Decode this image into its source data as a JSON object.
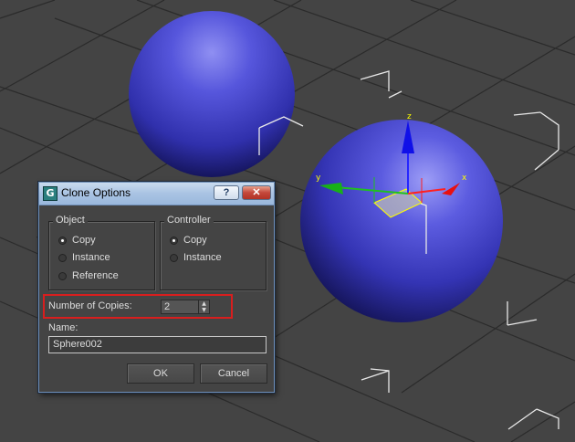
{
  "dialog": {
    "title": "Clone Options",
    "help_label": "?",
    "close_label": "✕",
    "object_group": {
      "legend": "Object",
      "options": [
        "Copy",
        "Instance",
        "Reference"
      ],
      "selected": "Copy"
    },
    "controller_group": {
      "legend": "Controller",
      "options": [
        "Copy",
        "Instance"
      ],
      "selected": "Copy"
    },
    "copies": {
      "label": "Number of Copies:",
      "value": "2"
    },
    "name": {
      "label": "Name:",
      "value": "Sphere002"
    },
    "ok_label": "OK",
    "cancel_label": "Cancel"
  },
  "viewport": {
    "background_color": "#444444",
    "grid_color": "#2b2b2b",
    "sphere_color": "#3f3fc0",
    "gizmo": {
      "x_label": "x",
      "y_label": "y",
      "z_label": "z"
    }
  },
  "colors": {
    "highlight_box": "#d81e1e",
    "title_bar": "#a9c3e3"
  }
}
